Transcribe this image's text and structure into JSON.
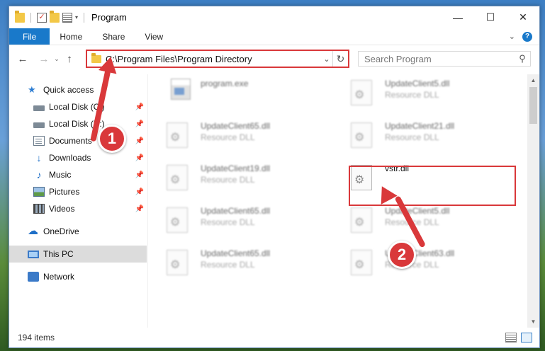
{
  "window": {
    "title": "Program",
    "controls": {
      "minimize": "—",
      "maximize": "☐",
      "close": "✕"
    }
  },
  "ribbon": {
    "tabs": [
      "File",
      "Home",
      "Share",
      "View"
    ]
  },
  "address": {
    "path": "C:\\Program Files\\Program Directory"
  },
  "search": {
    "placeholder": "Search Program"
  },
  "navpane": {
    "items": [
      {
        "label": "Quick access",
        "icon": "star-icon",
        "pinned": false
      },
      {
        "label": "Local Disk (C:)",
        "icon": "disk-icon",
        "pinned": true
      },
      {
        "label": "Local Disk (D:)",
        "icon": "disk-icon",
        "pinned": true
      },
      {
        "label": "Documents",
        "icon": "documents-icon",
        "pinned": true
      },
      {
        "label": "Downloads",
        "icon": "downloads-icon",
        "pinned": true
      },
      {
        "label": "Music",
        "icon": "music-icon",
        "pinned": true
      },
      {
        "label": "Pictures",
        "icon": "pictures-icon",
        "pinned": true
      },
      {
        "label": "Videos",
        "icon": "videos-icon",
        "pinned": true
      },
      {
        "label": "OneDrive",
        "icon": "onedrive-icon",
        "pinned": false
      },
      {
        "label": "This PC",
        "icon": "this-pc-icon",
        "pinned": false,
        "selected": true
      },
      {
        "label": "Network",
        "icon": "network-icon",
        "pinned": false
      }
    ]
  },
  "files": [
    {
      "name": "program.exe",
      "type": ""
    },
    {
      "name": "UpdateClient5.dll",
      "type": "Resource DLL"
    },
    {
      "name": "UpdateClient65.dll",
      "type": "Resource DLL"
    },
    {
      "name": "UpdateClient21.dll",
      "type": "Resource DLL"
    },
    {
      "name": "UpdateClient19.dll",
      "type": "Resource DLL"
    },
    {
      "name": "vstr.dll",
      "type": ""
    },
    {
      "name": "UpdateClient65.dll",
      "type": "Resource DLL"
    },
    {
      "name": "UpdateClient5.dll",
      "type": "Resource DLL"
    },
    {
      "name": "UpdateClient65.dll",
      "type": "Resource DLL"
    },
    {
      "name": "UpdateClient63.dll",
      "type": "Resource DLL"
    }
  ],
  "statusbar": {
    "item_count": "194 items"
  },
  "annotations": {
    "step1": "1",
    "step2": "2",
    "color": "#d9383a"
  }
}
